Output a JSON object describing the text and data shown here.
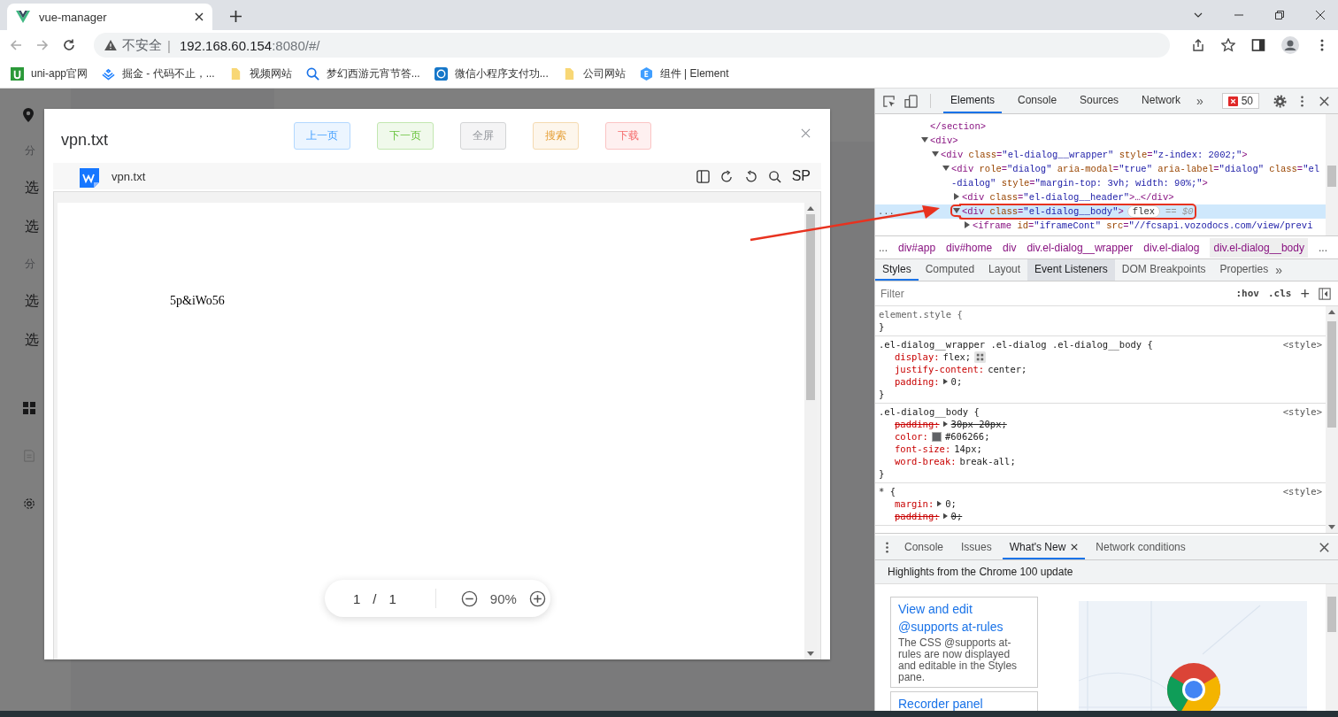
{
  "browser": {
    "tab_title": "vue-manager",
    "security": "不安全",
    "security_separator": "|",
    "url_host": "192.168.60.154",
    "url_rest": ":8080/#/",
    "bookmarks": [
      {
        "label": "uni-app官网"
      },
      {
        "label": "掘金 - 代码不止，..."
      },
      {
        "label": "视频网站"
      },
      {
        "label": "梦幻西游元宵节答..."
      },
      {
        "label": "微信小程序支付功..."
      },
      {
        "label": "公司网站"
      },
      {
        "label": "组件 | Element"
      }
    ]
  },
  "background_app": {
    "sidebar_items": [
      {
        "label": "分",
        "kind": "group"
      },
      {
        "label": "选",
        "kind": "item"
      },
      {
        "label": "选",
        "kind": "item"
      },
      {
        "label": "分",
        "kind": "group"
      },
      {
        "label": "选",
        "kind": "item"
      },
      {
        "label": "选",
        "kind": "item"
      }
    ]
  },
  "dialog": {
    "title": "vpn.txt",
    "buttons": [
      {
        "label": "上一页",
        "kind": "primary"
      },
      {
        "label": "下一页",
        "kind": "success"
      },
      {
        "label": "全屏",
        "kind": "info"
      },
      {
        "label": "搜索",
        "kind": "warning"
      },
      {
        "label": "下载",
        "kind": "danger"
      }
    ],
    "viewer": {
      "file_name": "vpn.txt",
      "mode_label": "SP",
      "document_text": "5p&iWo56",
      "page_current": "1",
      "page_separator": "/",
      "page_total": "1",
      "zoom": "90%"
    }
  },
  "devtools": {
    "tabs": [
      {
        "label": "Elements",
        "selected": true
      },
      {
        "label": "Console",
        "selected": false
      },
      {
        "label": "Sources",
        "selected": false
      },
      {
        "label": "Network",
        "selected": false
      }
    ],
    "more": "»",
    "error_count": "50",
    "dom_tree": [
      {
        "text": "</section>",
        "selected": false
      },
      {
        "text": "<div>",
        "expanded": true,
        "selected": false,
        "children": [
          {
            "text": "<div class=\"el-dialog__wrapper\" style=\"z-index: 2002;\">",
            "expanded": true,
            "selected": false,
            "children": [
              {
                "text": "<div role=\"dialog\" aria-modal=\"true\" aria-label=\"dialog\" class=\"el-dialog\" style=\"margin-top: 3vh; width: 90%;\">",
                "expanded": true,
                "selected": false,
                "children": [
                  {
                    "text": "<div class=\"el-dialog__header\">…</div>",
                    "expanded": false,
                    "selected": false
                  },
                  {
                    "text": "<div class=\"el-dialog__body\">",
                    "expanded": true,
                    "selected": true,
                    "badge": "flex",
                    "suffix": "== $0",
                    "children": [
                      {
                        "text": "<iframe id=\"iframeCont\" src=\"//fcsapi.vozodocs.com/view/previ",
                        "expanded": false,
                        "selected": false
                      }
                    ]
                  }
                ]
              }
            ]
          }
        ]
      }
    ],
    "row_dots": "...",
    "breadcrumbs": [
      {
        "label": "div#app",
        "selected": false
      },
      {
        "label": "div#home",
        "selected": false
      },
      {
        "label": "div",
        "selected": false
      },
      {
        "label": "div.el-dialog__wrapper",
        "selected": false
      },
      {
        "label": "div.el-dialog",
        "selected": false
      },
      {
        "label": "div.el-dialog__body",
        "selected": true
      }
    ],
    "breadcrumb_ellipsis_left": "...",
    "breadcrumb_ellipsis_right": "...",
    "sub_tabs": [
      {
        "label": "Styles",
        "selected": true,
        "hovered": false
      },
      {
        "label": "Computed",
        "selected": false,
        "hovered": false
      },
      {
        "label": "Layout",
        "selected": false,
        "hovered": false
      },
      {
        "label": "Event Listeners",
        "selected": false,
        "hovered": true
      },
      {
        "label": "DOM Breakpoints",
        "selected": false,
        "hovered": false
      },
      {
        "label": "Properties",
        "selected": false,
        "hovered": false
      }
    ],
    "filter_placeholder": "Filter",
    "hov": ":hov",
    "cls": ".cls",
    "plus": "+",
    "rules": [
      {
        "selector": "element.style {",
        "close": "}"
      },
      {
        "selector": ".el-dialog__wrapper .el-dialog .el-dialog__body {",
        "source": "<style>",
        "close": "}",
        "declarations": [
          {
            "prop": "display:",
            "value": "flex;",
            "struck": false,
            "expandable": false,
            "kind": "flex"
          },
          {
            "prop": "justify-content:",
            "value": "center;",
            "struck": false,
            "expandable": false,
            "kind": "plain"
          },
          {
            "prop": "padding:",
            "value": "0;",
            "struck": false,
            "expandable": true,
            "kind": "plain"
          }
        ]
      },
      {
        "selector": ".el-dialog__body {",
        "source": "<style>",
        "close": "}",
        "declarations": [
          {
            "prop": "padding:",
            "value": "30px 20px;",
            "struck": true,
            "expandable": true,
            "kind": "plain"
          },
          {
            "prop": "color:",
            "value": "#606266;",
            "struck": false,
            "expandable": false,
            "kind": "color"
          },
          {
            "prop": "font-size:",
            "value": "14px;",
            "struck": false,
            "expandable": false,
            "kind": "plain"
          },
          {
            "prop": "word-break:",
            "value": "break-all;",
            "struck": false,
            "expandable": false,
            "kind": "plain"
          }
        ]
      },
      {
        "selector": "* {",
        "source": "<style>",
        "declarations": [
          {
            "prop": "margin:",
            "value": "0;",
            "struck": false,
            "expandable": true,
            "kind": "plain"
          },
          {
            "prop": "padding:",
            "value": "0;",
            "struck": true,
            "expandable": true,
            "kind": "plain"
          }
        ]
      }
    ],
    "drawer_tabs": [
      {
        "label": "Console",
        "selected": false
      },
      {
        "label": "Issues",
        "selected": false
      },
      {
        "label": "What's New",
        "selected": true
      },
      {
        "label": "Network conditions",
        "selected": false
      }
    ],
    "whats_new_heading": "Highlights from the Chrome 100 update",
    "cards": [
      {
        "title": "View and edit @supports at-rules",
        "description": "The CSS @supports at-rules are now displayed and editable in the Styles pane."
      },
      {
        "title": "Recorder panel"
      }
    ]
  }
}
